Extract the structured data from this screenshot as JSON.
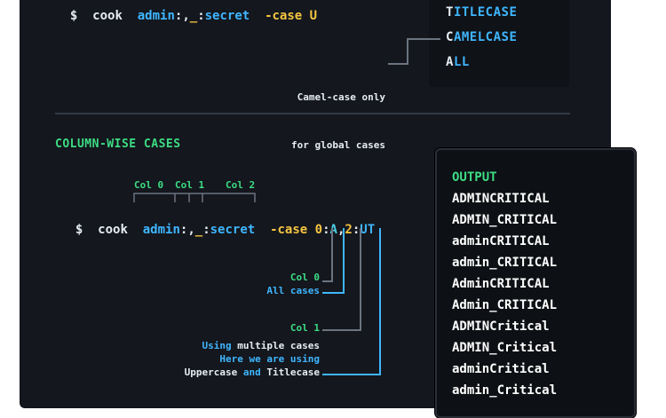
{
  "top_command": {
    "prompt": "$",
    "cmd": "cook",
    "arg1": "admin",
    "sep1": ":,",
    "sep2": "_",
    "sep3": ":",
    "arg2": "secret",
    "flag": "-case",
    "val": "U"
  },
  "case_options": [
    {
      "first": "T",
      "rest": "ITLECASE"
    },
    {
      "first": "C",
      "rest": "AMELCASE"
    },
    {
      "first": "A",
      "rest": "LL"
    }
  ],
  "camel_note": [
    "Camel-case only",
    "for global cases"
  ],
  "section_title": "COLUMN-WISE CASES",
  "col_labels": [
    "Col 0",
    "Col 1",
    "Col 2"
  ],
  "command": {
    "prompt": "$",
    "cmd": "cook",
    "arg1": "admin",
    "sep1": ":,",
    "sep2": "_",
    "sep3": ":",
    "arg2": "secret",
    "flag": "-case",
    "c0": "0",
    "colon1": ":",
    "a": "A",
    "comma": ",",
    "c2": "2",
    "colon2": ":",
    "ut": "UT"
  },
  "annotations": {
    "col0_title": "Col 0",
    "col0_desc": "All cases",
    "col1_title": "Col 1",
    "multi_1a": "Using",
    "multi_1b": "multiple cases",
    "multi_2": "Here we are using",
    "multi_3a": "Uppercase",
    "multi_3b": "and",
    "multi_3c": "Titlecase"
  },
  "output": {
    "title": "OUTPUT",
    "lines": [
      "ADMINCRITICAL",
      "ADMIN_CRITICAL",
      "adminCRITICAL",
      "admin_CRITICAL",
      "AdminCRITICAL",
      "Admin_CRITICAL",
      "ADMINCritical",
      "ADMIN_Critical",
      "adminCritical",
      "admin_Critical"
    ]
  },
  "colors": {
    "panel": "#14171d",
    "accent_green": "#3ddc84",
    "accent_blue": "#3fb6ff",
    "accent_yellow": "#f5c542",
    "accent_cyan": "#4ad4e6"
  }
}
